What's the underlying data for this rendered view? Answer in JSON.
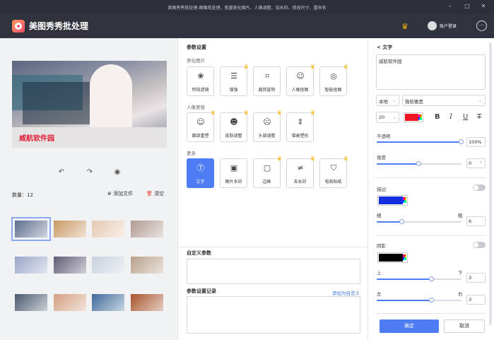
{
  "window": {
    "title": "美图秀秀批处理-图像批处理，批量美化图片、人像调整、加水印、修改尺寸、重命名"
  },
  "app": {
    "name": "美图秀秀批处理",
    "login": "账户登录"
  },
  "left": {
    "watermark_text": "威航软件园",
    "count_label": "数量：12",
    "add_file": "添加文件",
    "clear": "清空",
    "thumb_colors": [
      "#5e6e8f",
      "#c89a66",
      "#e6c8b2",
      "#b09a92",
      "#9aa6c8",
      "#5f5a74",
      "#c7d1de",
      "#b9a08a",
      "#4a5a6e",
      "#d4a082",
      "#3f6a9a",
      "#a6532b"
    ]
  },
  "middle": {
    "section_title": "参数设置",
    "group1": "美化图片",
    "group1_items": [
      "特效滤镜",
      "增强",
      "裁剪旋转",
      "人像抠图",
      "智能抠图"
    ],
    "group2": "人像美容",
    "group2_items": [
      "面部重塑",
      "皮肤调整",
      "头部调整",
      "增高塑形"
    ],
    "group3": "更多",
    "group3_items": [
      "文字",
      "图片水印",
      "边框",
      "去水印",
      "电商贴纸"
    ],
    "custom_params": "自定义参数",
    "history": "参数设置记录",
    "add_custom": "添加为自定义"
  },
  "right": {
    "title": "< 文字",
    "text_value": "威航软件园",
    "font_source": "本地",
    "font_name": "微软雅黑",
    "font_size": "20",
    "text_color": "#f01324",
    "format_buttons": [
      "B",
      "I",
      "U",
      "T"
    ],
    "opacity_label": "不透明",
    "opacity_value": "100%",
    "opacity_level": 1.0,
    "angle_label": "角度",
    "angle_value": "0",
    "angle_unit": "°",
    "angle_level": 0.5,
    "stroke_label": "描边",
    "stroke_color": "#1230e0",
    "thin_label": "细",
    "thick_label": "粗",
    "stroke_value": "6",
    "stroke_level": 0.3,
    "shadow_label": "阴影",
    "shadow_color": "#000000",
    "up_label": "上",
    "down_label": "下",
    "vertical_value": "3",
    "vertical_level": 0.65,
    "left_label": "左",
    "right_label": "右",
    "horizontal_value": "3",
    "horizontal_level": 0.65,
    "confirm": "确定",
    "cancel": "取消"
  },
  "colors": {
    "accent": "#4d7cf3",
    "vip_crown": "#f5b400",
    "titlebar": "#2d2f3a"
  }
}
